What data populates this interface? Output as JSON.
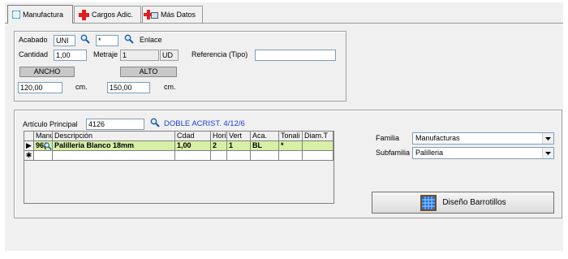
{
  "tabs": [
    {
      "label": "Manufactura",
      "icon": "manufactura-icon"
    },
    {
      "label": "Cargos Adic.",
      "icon": "plus-icon"
    },
    {
      "label": "Más Datos",
      "icon": "add-data-icon"
    }
  ],
  "top": {
    "acabado_label": "Acabado",
    "acabado_value": "UNI",
    "field2_value": "*",
    "enlace_label": "Enlace",
    "cantidad_label": "Cantidad",
    "cantidad_value": "1,00",
    "metraje_label": "Metraje",
    "metraje_value": "1",
    "unit_value": "UD",
    "referencia_label": "Referencia (Tipo)",
    "referencia_value": "",
    "ancho_label": "ANCHO",
    "alto_label": "ALTO",
    "ancho_value": "120,00",
    "alto_value": "150,00",
    "unit_cm1": "cm.",
    "unit_cm2": "cm."
  },
  "article": {
    "label": "Artículo Principal",
    "value": "4126",
    "description": "DOBLE ACRIST. 4/12/6"
  },
  "grid": {
    "headers": [
      "Manuf.",
      "Descripción",
      "Cdad",
      "Horiz",
      "Vert",
      "Aca.",
      "Tonali",
      "Diam.T"
    ],
    "row": {
      "manuf": "96(",
      "descripcion": "Palilleria Blanco 18mm",
      "cdad": "1,00",
      "horiz": "2",
      "vert": "1",
      "aca": "BL",
      "tonali": "*",
      "diam": ""
    }
  },
  "right": {
    "familia_label": "Familia",
    "familia_value": "Manufacturas",
    "subfamilia_label": "Subfamilia",
    "subfamilia_value": "Palilleria",
    "button_label": "Diseño Barrotillos"
  },
  "colors": {
    "selected_row": "#d7f0a6",
    "link_text": "#1f3fd6",
    "accent_red": "#e02020"
  }
}
